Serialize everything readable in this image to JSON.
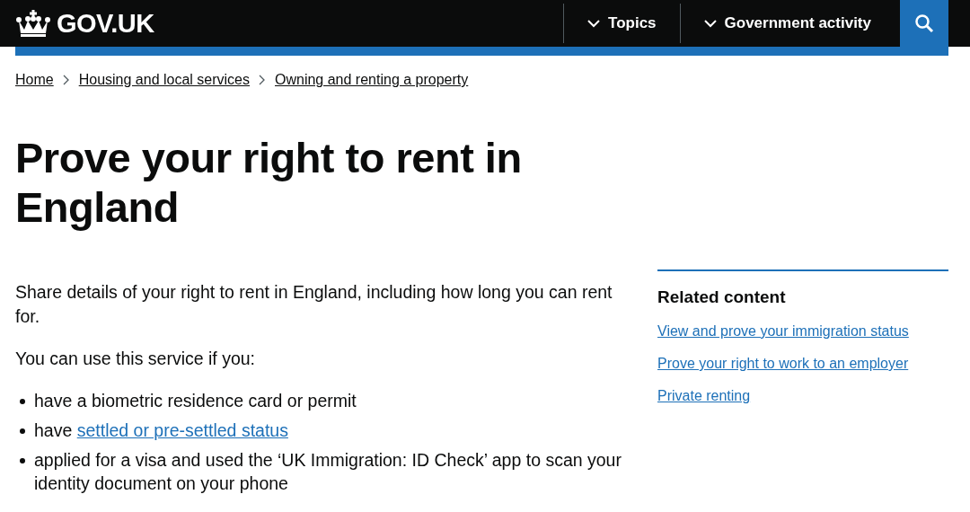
{
  "header": {
    "logo": "GOV.UK",
    "nav": [
      {
        "label": "Topics",
        "expanded": false
      },
      {
        "label": "Government activity",
        "expanded": false
      }
    ]
  },
  "breadcrumbs": [
    "Home",
    "Housing and local services",
    "Owning and renting a property"
  ],
  "title": "Prove your right to rent in England",
  "intro": "Share details of your right to rent in England, including how long you can rent for.",
  "lead": "You can use this service if you:",
  "bullets": [
    {
      "text": "have a biometric residence card or permit"
    },
    {
      "text": "have ",
      "link": "settled or pre-settled status"
    },
    {
      "text": "applied for a visa and used the ‘UK Immigration: ID Check’ app to scan your identity document on your phone"
    }
  ],
  "related": {
    "heading": "Related content",
    "links": [
      "View and prove your immigration status",
      "Prove your right to work to an employer",
      "Private renting"
    ]
  }
}
